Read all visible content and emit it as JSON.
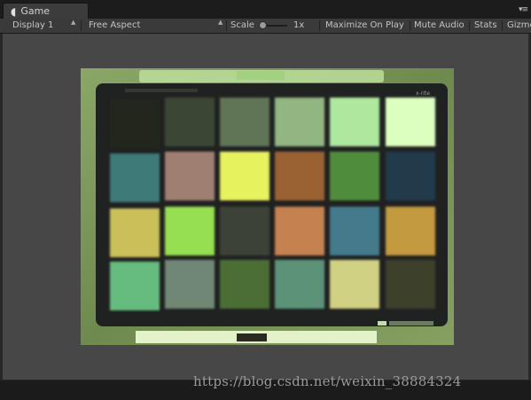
{
  "tab": {
    "title": "Game",
    "icon": "unity-game-icon"
  },
  "toolbar": {
    "display": "Display 1",
    "aspect": "Free Aspect",
    "scale_label": "Scale",
    "scale_value": "1x",
    "maximize": "Maximize On Play",
    "mute": "Mute Audio",
    "stats": "Stats",
    "gizmos": "Gizmos"
  },
  "footer": {
    "watermark": "https://blog.csdn.net/weixin_38884324"
  },
  "swatches": [
    [
      "#23281e",
      "#3b4634",
      "#5f7456",
      "#92b682",
      "#ade89e",
      "#dcffc0"
    ],
    [
      "#3d7a78",
      "#a07f73",
      "#e7f25e",
      "#9a6232",
      "#4f8d3c",
      "#243b4b"
    ],
    [
      "#c9c05a",
      "#96df52",
      "#3d4237",
      "#c5814f",
      "#447a8d",
      "#c39a3f"
    ],
    [
      "#66bc7f",
      "#6f8774",
      "#4c6e35",
      "#5b9378",
      "#d0d182",
      "#3c3f2b"
    ]
  ]
}
